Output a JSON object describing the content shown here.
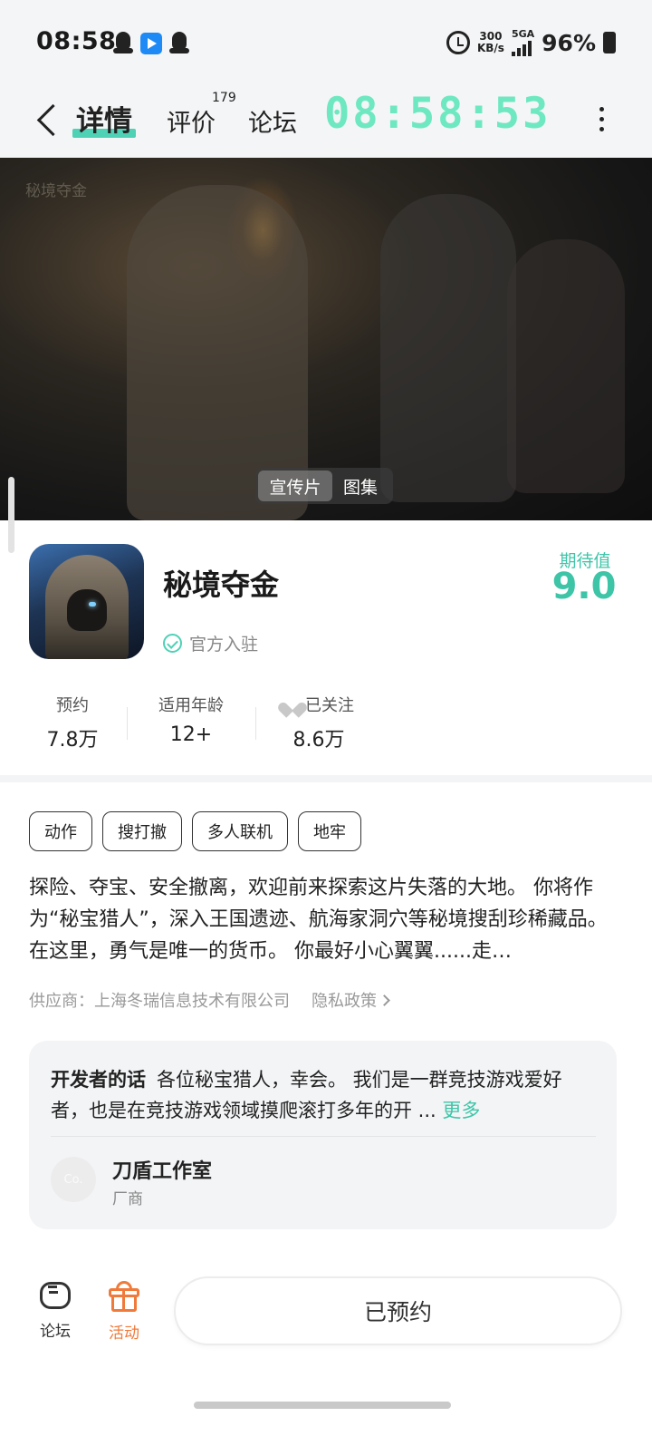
{
  "status_bar": {
    "time": "08:58",
    "net_speed_value": "300",
    "net_speed_unit": "KB/s",
    "signal_label": "5GA",
    "battery": "96%"
  },
  "header": {
    "tabs": [
      {
        "label": "详情",
        "active": true
      },
      {
        "label": "评价",
        "badge": "179"
      },
      {
        "label": "论坛"
      }
    ],
    "clock": "08:58:53",
    "accent_color": "#4fd1b5"
  },
  "hero": {
    "watermark": "秘境夺金",
    "media_tabs": [
      "宣传片",
      "图集"
    ],
    "active_media_tab": "宣传片"
  },
  "game": {
    "title": "秘境夺金",
    "verified_label": "官方入驻",
    "expect_label": "期待值",
    "expect_score": "9.0",
    "stats": [
      {
        "label": "预约",
        "value": "7.8万"
      },
      {
        "label": "适用年龄",
        "value": "12+"
      },
      {
        "label": "已关注",
        "value": "8.6万"
      }
    ],
    "tags": [
      "动作",
      "搜打撤",
      "多人联机",
      "地牢"
    ],
    "description": "探险、夺宝、安全撤离，欢迎前来探索这片失落的大地。 你将作为“秘宝猎人”，深入王国遗迹、航海家洞穴等秘境搜刮珍稀藏品。在这里，勇气是唯一的货币。 你最好小心翼翼......走…",
    "supplier": "供应商：上海冬瑞信息技术有限公司",
    "privacy_label": "隐私政策"
  },
  "developer": {
    "words_title": "开发者的话",
    "words_text": "各位秘宝猎人，幸会。 我们是一群竞技游戏爱好者，也是在竞技游戏领域摸爬滚打多年的开 ...",
    "more_label": "更多",
    "avatar_text": "Co.",
    "name": "刀盾工作室",
    "role": "厂商"
  },
  "bottom_bar": {
    "forum_label": "论坛",
    "activity_label": "活动",
    "activity_color": "#f07a3a",
    "reserve_button": "已预约"
  }
}
